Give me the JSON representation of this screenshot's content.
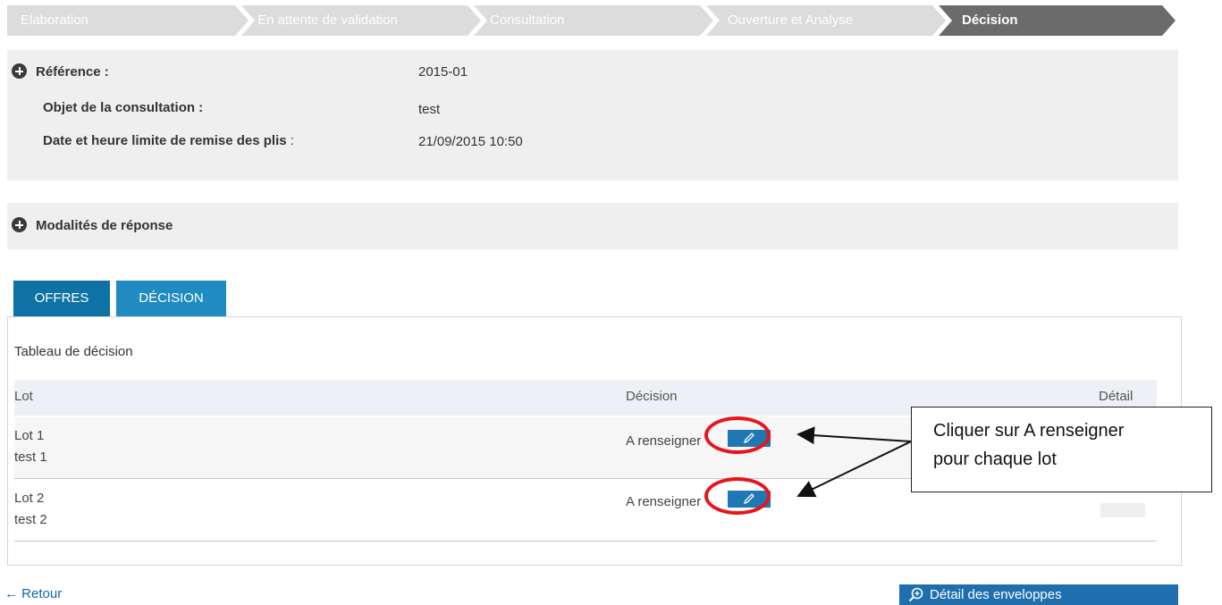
{
  "steps": [
    {
      "label": "Elaboration",
      "active": false
    },
    {
      "label": "En attente de validation",
      "active": false
    },
    {
      "label": "Consultation",
      "active": false
    },
    {
      "label": "Ouverture et Analyse",
      "active": false
    },
    {
      "label": "Décision",
      "active": true
    }
  ],
  "info": {
    "reference_label": "Référence :",
    "reference_value": "2015-01",
    "objet_label": "Objet de la consultation :",
    "objet_value": "test",
    "date_label": "Date et heure limite de remise des plis",
    "date_colon": ":",
    "date_value": "21/09/2015 10:50"
  },
  "modalites": {
    "label": "Modalités de réponse"
  },
  "tabs": [
    {
      "label": "OFFRES",
      "active": true
    },
    {
      "label": "DÉCISION",
      "active": false
    }
  ],
  "table": {
    "title": "Tableau de décision",
    "columns": [
      "Lot",
      "Décision",
      "Détail"
    ],
    "rows": [
      {
        "lot": "Lot 1",
        "desc": "test 1",
        "decision": "A renseigner"
      },
      {
        "lot": "Lot 2",
        "desc": "test 2",
        "decision": "A renseigner"
      }
    ]
  },
  "footer": {
    "back_label": "← Retour",
    "enveloppes_label": "Détail des enveloppes"
  },
  "annotation": {
    "line1": "Cliquer sur A renseigner",
    "line2": "pour chaque lot"
  },
  "colors": {
    "step_inactive": "#dcdcdc",
    "step_active": "#6b6b6b",
    "tab_active": "#0e72a4",
    "tab_inactive": "#1f8bc0",
    "annotation_ring": "#e8141b"
  },
  "icons": {
    "expand": "circle-plus-icon",
    "edit": "pencil-icon",
    "search": "magnifier-plus-icon"
  }
}
